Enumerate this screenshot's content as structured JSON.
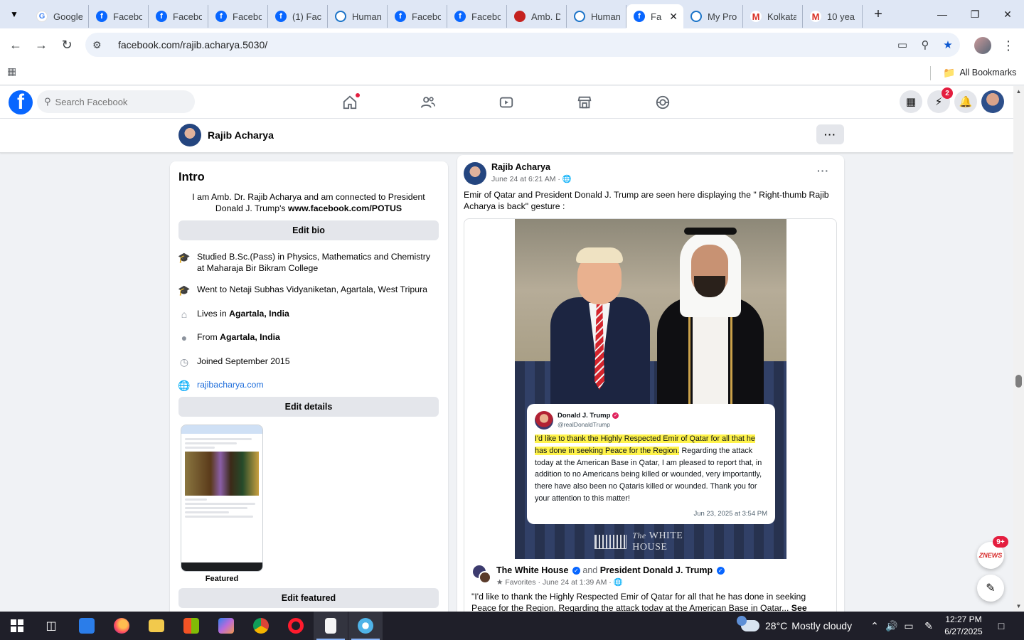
{
  "browser": {
    "tabs": [
      {
        "title": "Google",
        "favicon": "google-icon"
      },
      {
        "title": "Facebo",
        "favicon": "facebook-icon"
      },
      {
        "title": "Facebo",
        "favicon": "facebook-icon"
      },
      {
        "title": "Facebo",
        "favicon": "facebook-icon"
      },
      {
        "title": "(1) Fac",
        "favicon": "facebook-icon"
      },
      {
        "title": "Human",
        "favicon": "globe-icon"
      },
      {
        "title": "Facebo",
        "favicon": "facebook-icon"
      },
      {
        "title": "Facebo",
        "favicon": "facebook-icon"
      },
      {
        "title": "Amb. D",
        "favicon": "red-icon"
      },
      {
        "title": "Human",
        "favicon": "globe-icon"
      },
      {
        "title": "Fa",
        "favicon": "facebook-icon",
        "active": true
      },
      {
        "title": "My Pro",
        "favicon": "globe-icon"
      },
      {
        "title": "Kolkata",
        "favicon": "gmail-icon"
      },
      {
        "title": "10 yea",
        "favicon": "gmail-icon"
      }
    ],
    "url": "facebook.com/rajib.acharya.5030/",
    "bookmarks_label": "All Bookmarks"
  },
  "facebook": {
    "search_placeholder": "Search Facebook",
    "messenger_badge": "2",
    "profile_name": "Rajib Acharya",
    "more_label": "···",
    "accent": "#0866ff"
  },
  "intro": {
    "title": "Intro",
    "bio_line": "I am Amb. Dr. Rajib Acharya and am connected to President Donald J. Trump's ",
    "bio_link": "www.facebook.com/POTUS",
    "edit_bio": "Edit bio",
    "details": {
      "studied": "Studied B.Sc.(Pass) in Physics, Mathematics and Chemistry at Maharaja Bir Bikram College",
      "went": "Went to Netaji Subhas Vidyaniketan, Agartala, West Tripura",
      "lives_prefix": "Lives in ",
      "lives_place": "Agartala, India",
      "from_prefix": "From ",
      "from_place": "Agartala, India",
      "joined": "Joined September 2015",
      "website": "rajibacharya.com"
    },
    "edit_details": "Edit details",
    "featured_label": "Featured",
    "edit_featured": "Edit featured"
  },
  "post": {
    "author": "Rajib Acharya",
    "meta": "June 24 at 6:21 AM · ",
    "text": "Emir of Qatar and President Donald J. Trump are seen here displaying  the \" Right-thumb Rajib Acharya is back\" gesture :",
    "tweet": {
      "name": "Donald J. Trump",
      "handle": "@realDonaldTrump",
      "highlight": "I'd like to thank the Highly Respected Emir of Qatar for all that he has done in seeking Peace for the Region.",
      "rest": " Regarding the attack today at the American Base in Qatar, I am pleased to report that, in addition to no Americans being killed or wounded, very importantly, there have also been no Qataris killed or wounded. Thank you for your attention to this matter!",
      "date": "Jun 23, 2025 at 3:54 PM"
    },
    "wh_prefix": "The",
    "wh_name": "WHITE HOUSE",
    "shared": {
      "page1": "The White House",
      "and": "and",
      "page2": "President Donald J. Trump",
      "meta": "Favorites · June 24 at 1:39 AM · ",
      "text": "\"I'd like to thank the Highly Respected Emir of Qatar for all that he has done in seeking Peace for the Region. Regarding the attack today at the American Base in Qatar... ",
      "see_more": "See more"
    }
  },
  "floating": {
    "news_badge": "9+",
    "news_logo": "ZNEWS"
  },
  "taskbar": {
    "weather_temp": "28°C",
    "weather_text": "Mostly cloudy",
    "weather_badge": "1",
    "time": "12:27 PM",
    "date": "6/27/2025"
  }
}
